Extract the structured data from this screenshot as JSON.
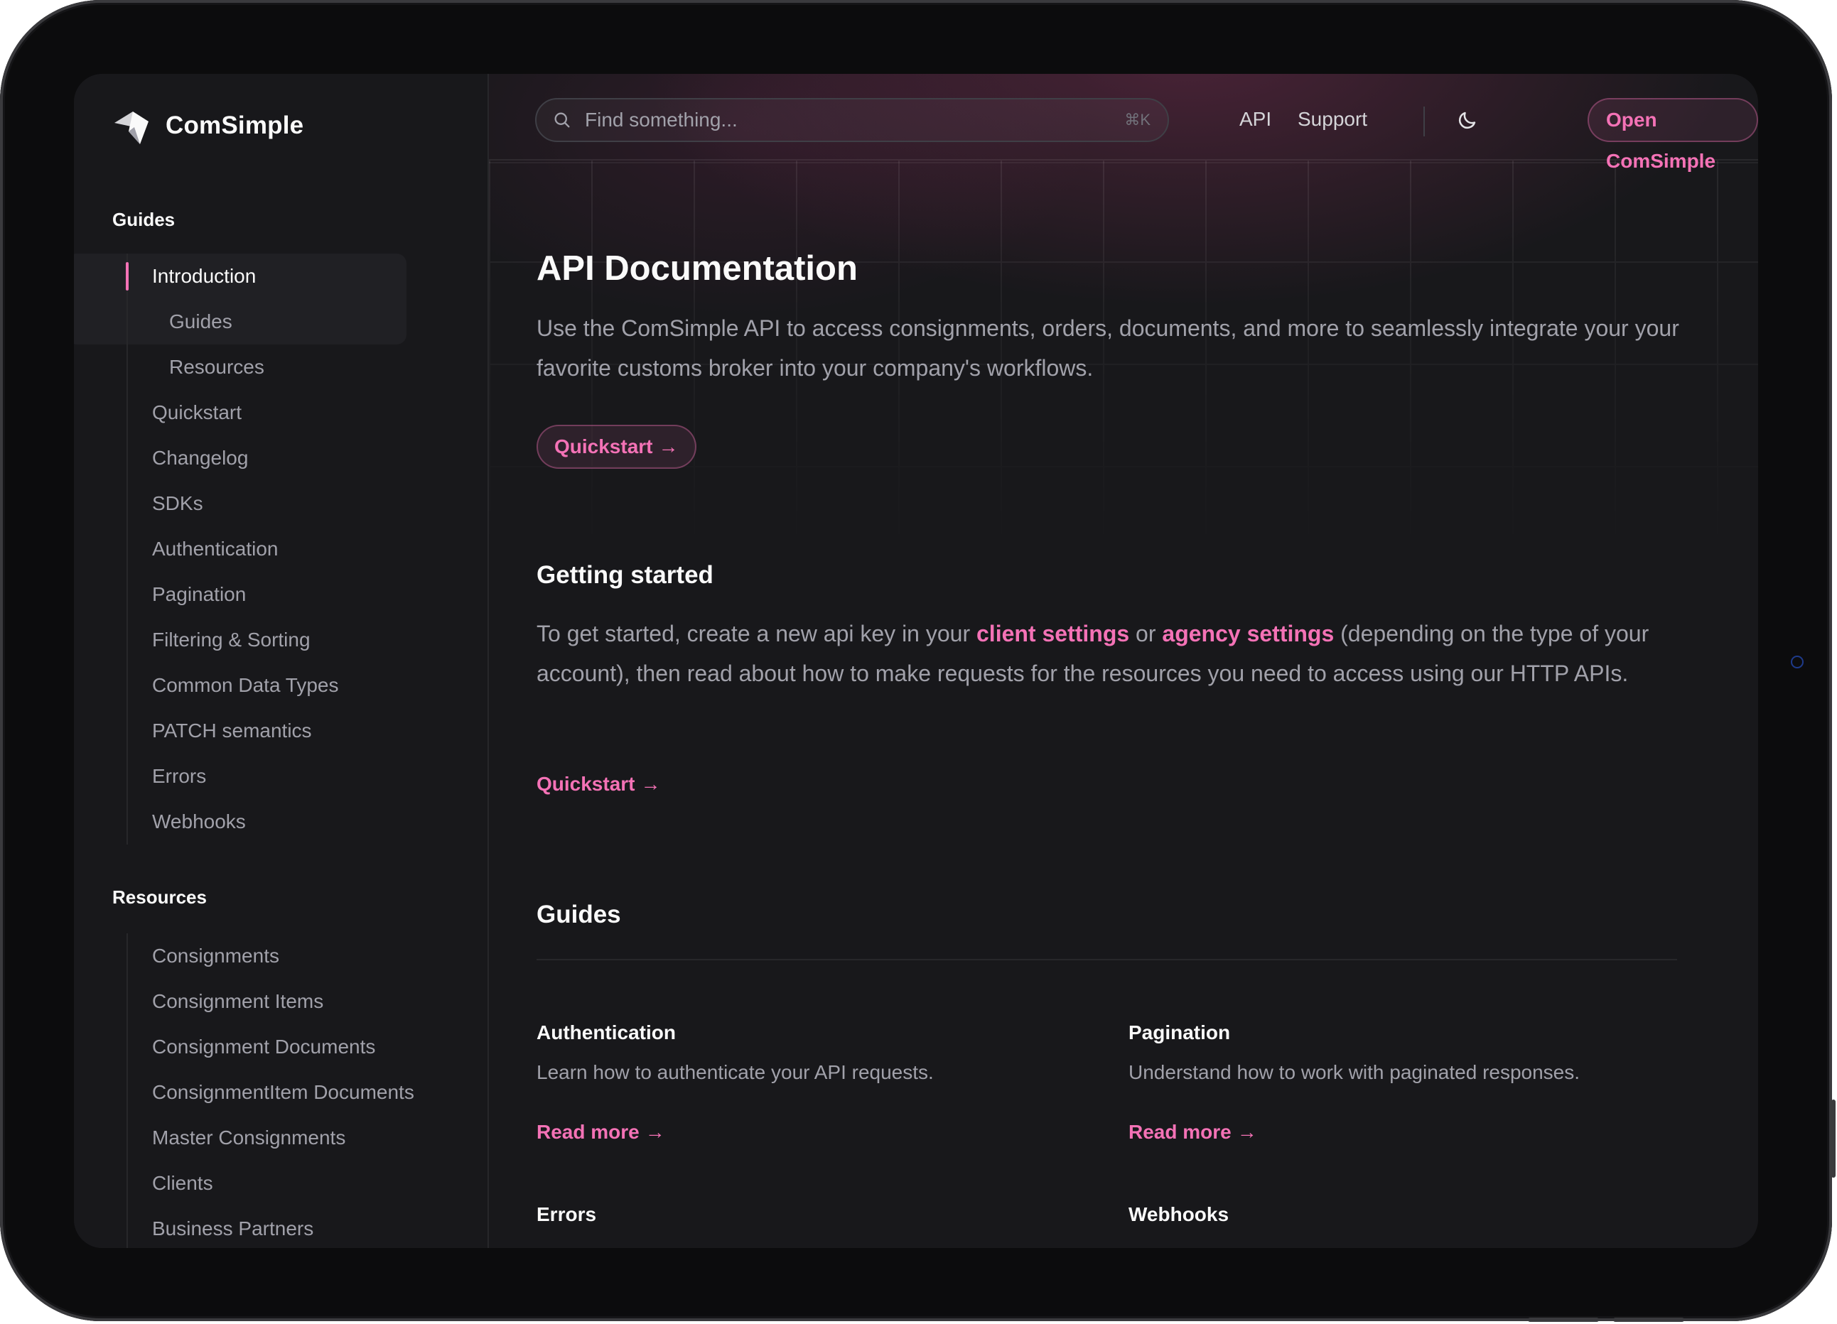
{
  "brand": {
    "name": "ComSimple"
  },
  "topbar": {
    "search_placeholder": "Find something...",
    "search_shortcut": "⌘K",
    "links": [
      "API",
      "Support"
    ],
    "cta": "Open ComSimple"
  },
  "sidebar": {
    "guides_title": "Guides",
    "guides": [
      {
        "label": "Introduction",
        "active": true,
        "level": 1
      },
      {
        "label": "Guides",
        "level": 2
      },
      {
        "label": "Resources",
        "level": 2
      },
      {
        "label": "Quickstart",
        "level": 1
      },
      {
        "label": "Changelog",
        "level": 1
      },
      {
        "label": "SDKs",
        "level": 1
      },
      {
        "label": "Authentication",
        "level": 1
      },
      {
        "label": "Pagination",
        "level": 1
      },
      {
        "label": "Filtering & Sorting",
        "level": 1
      },
      {
        "label": "Common Data Types",
        "level": 1
      },
      {
        "label": "PATCH semantics",
        "level": 1
      },
      {
        "label": "Errors",
        "level": 1
      },
      {
        "label": "Webhooks",
        "level": 1
      }
    ],
    "resources_title": "Resources",
    "resources": [
      {
        "label": "Consignments"
      },
      {
        "label": "Consignment Items"
      },
      {
        "label": "Consignment Documents"
      },
      {
        "label": "ConsignmentItem Documents"
      },
      {
        "label": "Master Consignments"
      },
      {
        "label": "Clients"
      },
      {
        "label": "Business Partners"
      }
    ]
  },
  "main": {
    "title": "API Documentation",
    "lead": "Use the ComSimple API to access consignments, orders, documents, and more to seamlessly integrate your your favorite customs broker into your company's workflows.",
    "hero_button": "Quickstart",
    "getting_started": {
      "title": "Getting started",
      "text_1": "To get started, create a new api key in your ",
      "link_1": "client settings",
      "text_2": " or ",
      "link_2": "agency settings",
      "text_3": " (depending on the type of your account), then read about how to make requests for the resources you need to access using our HTTP APIs.",
      "link": "Quickstart"
    },
    "guides": {
      "title": "Guides",
      "read_more": "Read more",
      "cards": [
        {
          "title": "Authentication",
          "description": "Learn how to authenticate your API requests."
        },
        {
          "title": "Pagination",
          "description": "Understand how to work with paginated responses."
        },
        {
          "title": "Errors",
          "description": ""
        },
        {
          "title": "Webhooks",
          "description": ""
        }
      ]
    }
  },
  "colors": {
    "accent": "#f472b6",
    "background": "#18181b",
    "text": "#fafafa",
    "muted": "#a1a1aa"
  },
  "icons": [
    "logo-icon",
    "search-icon",
    "moon-icon",
    "arrow-right-icon"
  ]
}
